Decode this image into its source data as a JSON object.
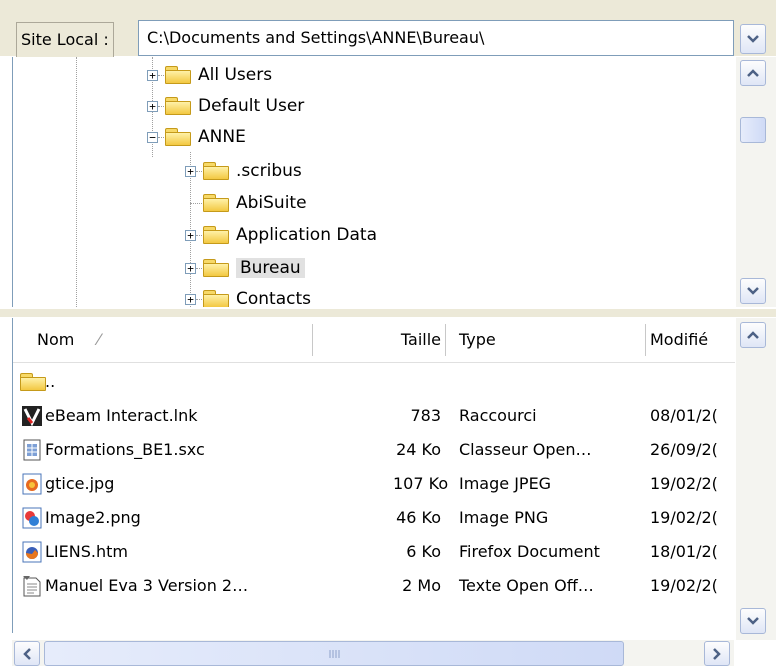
{
  "address": {
    "label": "Site Local :",
    "path": "C:\\Documents and Settings\\ANNE\\Bureau\\"
  },
  "tree": [
    {
      "label": "All Users",
      "expander": "+"
    },
    {
      "label": "Default User",
      "expander": "+"
    },
    {
      "label": "ANNE",
      "expander": "−"
    },
    {
      "label": ".scribus",
      "expander": "+"
    },
    {
      "label": "AbiSuite",
      "expander": ""
    },
    {
      "label": "Application Data",
      "expander": "+"
    },
    {
      "label": "Bureau",
      "expander": "+"
    },
    {
      "label": "Contacts",
      "expander": "+"
    }
  ],
  "list": {
    "columns": {
      "name": "Nom",
      "sort_glyph": "⁄",
      "size": "Taille",
      "type": "Type",
      "modified": "Modifié"
    },
    "parent_label": "..",
    "rows": [
      {
        "name": "eBeam Interact.lnk",
        "size": "783",
        "type": "Raccourci",
        "modified": "08/01/2(",
        "icon": "ebeam-shortcut-icon"
      },
      {
        "name": "Formations_BE1.sxc",
        "size": "24 Ko",
        "type": "Classeur Open…",
        "modified": "26/09/2(",
        "icon": "spreadsheet-file-icon"
      },
      {
        "name": "gtice.jpg",
        "size": "107 Ko",
        "type": "Image JPEG",
        "modified": "19/02/2(",
        "icon": "jpeg-image-icon"
      },
      {
        "name": "Image2.png",
        "size": "46 Ko",
        "type": "Image PNG",
        "modified": "19/02/2(",
        "icon": "png-image-icon"
      },
      {
        "name": "LIENS.htm",
        "size": "6 Ko",
        "type": "Firefox Document",
        "modified": "18/01/2(",
        "icon": "firefox-document-icon"
      },
      {
        "name": "Manuel Eva 3 Version 2…",
        "size": "2 Mo",
        "type": "Texte Open Off…",
        "modified": "19/02/2(",
        "icon": "text-document-icon"
      }
    ]
  },
  "icons": {
    "dropdown": "chevron-down-icon",
    "scroll_up": "chevron-up-icon",
    "scroll_left": "chevron-left-icon",
    "scroll_right": "chevron-right-icon"
  },
  "colors": {
    "chrome": "#ece9d8",
    "border": "#7f9db9",
    "folder": "#f3c842",
    "selected": "#e1e1e1"
  }
}
